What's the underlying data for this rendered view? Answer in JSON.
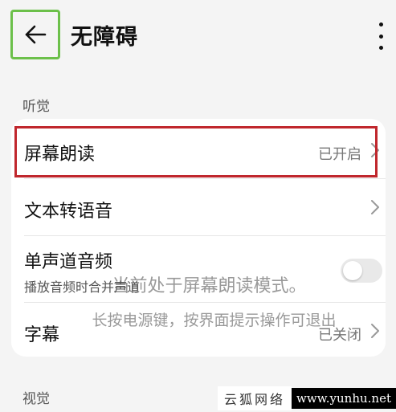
{
  "header": {
    "title": "无障碍",
    "back_icon": "arrow-left-icon",
    "more_icon": "more-vertical-icon"
  },
  "sections": {
    "hearing_label": "听觉",
    "vision_label": "视觉"
  },
  "rows": {
    "screen_reader": {
      "label": "屏幕朗读",
      "value": "已开启"
    },
    "tts": {
      "label": "文本转语音"
    },
    "mono_audio": {
      "label": "单声道音频",
      "subtitle": "播放音频时合并声道",
      "toggle_on": false
    },
    "captions": {
      "label": "字幕",
      "value": "已关闭"
    }
  },
  "toast": {
    "line1": "当前处于屏幕朗读模式。",
    "line2": "长按电源键，按界面提示操作可退出"
  },
  "watermark": {
    "left": "云狐网络",
    "right": "www.yunhu.net"
  },
  "colors": {
    "highlight": "#c0272d",
    "back_box": "#6cc04a"
  }
}
